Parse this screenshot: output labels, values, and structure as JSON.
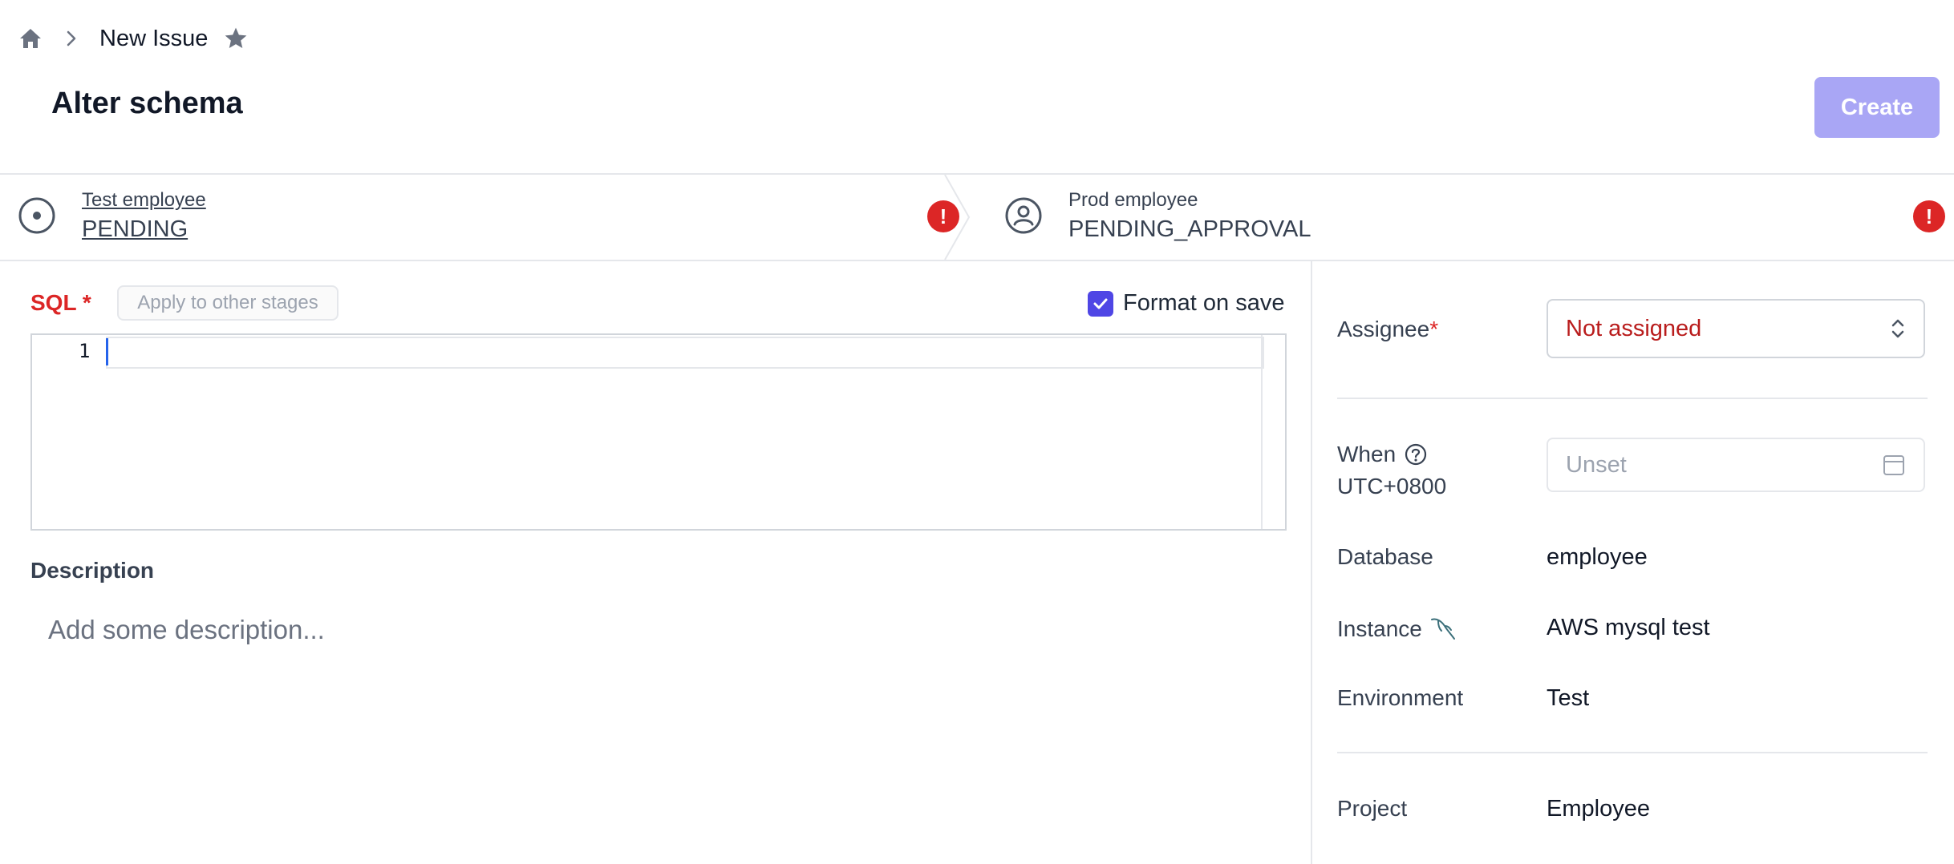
{
  "breadcrumb": {
    "current": "New Issue"
  },
  "page": {
    "title": "Alter schema",
    "create_label": "Create"
  },
  "pipeline": [
    {
      "environment": "Test employee",
      "status": "PENDING"
    },
    {
      "environment": "Prod employee",
      "status": "PENDING_APPROVAL"
    }
  ],
  "editor": {
    "sql_label": "SQL",
    "required_mark": "*",
    "apply_label": "Apply to other stages",
    "format_on_save_label": "Format on save",
    "format_on_save": true,
    "line_numbers": [
      "1"
    ]
  },
  "description": {
    "label": "Description",
    "placeholder": "Add some description..."
  },
  "sidebar": {
    "assignee_label": "Assignee",
    "assignee_value": "Not assigned",
    "when_label": "When",
    "timezone": "UTC+0800",
    "when_placeholder": "Unset",
    "database_label": "Database",
    "database_value": "employee",
    "instance_label": "Instance",
    "instance_value": "AWS mysql test",
    "environment_label": "Environment",
    "environment_value": "Test",
    "project_label": "Project",
    "project_value": "Employee"
  },
  "icons": {
    "home": "home-icon",
    "chevron": "chevron-right-icon",
    "star": "star-icon",
    "stage_active": "radio-dot-icon",
    "stage_user": "user-circle-icon",
    "error": "exclamation-icon",
    "check": "check-icon",
    "help": "question-circle-icon",
    "calendar": "calendar-icon",
    "updown": "chevron-up-down-icon",
    "mysql": "mysql-dolphin-icon"
  },
  "colors": {
    "accent": "#4f46e5",
    "create_disabled": "#a9a6f5",
    "error": "#dc2626",
    "required": "#dc2626"
  }
}
